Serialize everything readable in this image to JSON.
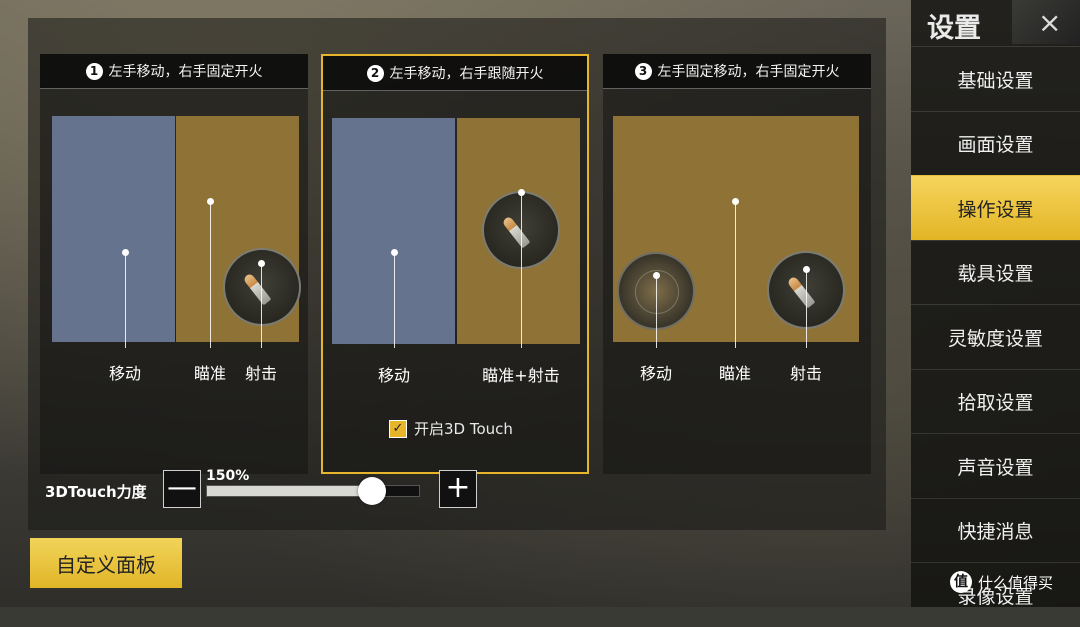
{
  "modes": [
    {
      "number": "1",
      "title": "左手移动，右手固定开火",
      "labels": {
        "move": "移动",
        "aim": "瞄准",
        "fire": "射击"
      }
    },
    {
      "number": "2",
      "title": "左手移动，右手跟随开火",
      "labels": {
        "move": "移动",
        "aim_fire": "瞄准+射击"
      },
      "checkbox_label": "开启3D Touch",
      "checkbox_checked": true
    },
    {
      "number": "3",
      "title": "左手固定移动，右手固定开火",
      "labels": {
        "move": "移动",
        "aim": "瞄准",
        "fire": "射击"
      }
    }
  ],
  "selected_mode": 2,
  "force": {
    "label": "3DTouch力度",
    "value_text": "150%",
    "minus": "—",
    "plus": "+",
    "fill_fraction": 0.78
  },
  "custom_panel_button": "自定义面板",
  "sidebar": {
    "title": "设置",
    "close_icon": "×",
    "items": [
      "基础设置",
      "画面设置",
      "操作设置",
      "载具设置",
      "灵敏度设置",
      "拾取设置",
      "声音设置",
      "快捷消息",
      "录像设置"
    ],
    "active_index": 2
  },
  "watermark": {
    "logo": "值",
    "text": "什么值得买"
  },
  "colors": {
    "accent": "#e7b52b",
    "zone_blue": "#66738e",
    "zone_gold": "#8f7235"
  }
}
